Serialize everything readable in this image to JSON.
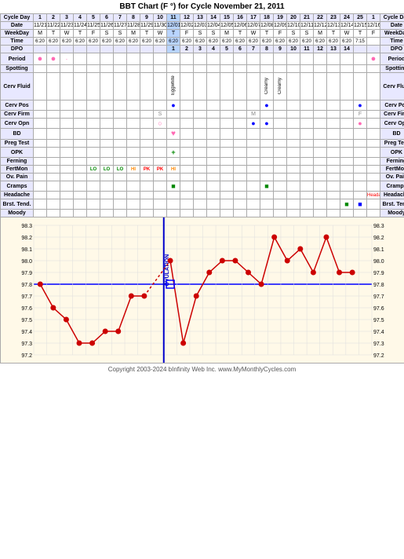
{
  "title": "BBT Chart (F °) for Cycle November 21, 2011",
  "footer": "Copyright 2003-2024 bInfinity Web Inc.    www.MyMonthlyCycles.com",
  "cycleDays": [
    "1",
    "2",
    "3",
    "4",
    "5",
    "6",
    "7",
    "8",
    "9",
    "10",
    "11",
    "12",
    "13",
    "14",
    "15",
    "16",
    "17",
    "18",
    "19",
    "20",
    "21",
    "22",
    "23",
    "24",
    "25",
    "1"
  ],
  "dates": [
    "11/21",
    "11/22",
    "11/23",
    "11/24",
    "11/25",
    "11/26",
    "11/27",
    "11/28",
    "11/29",
    "11/30",
    "12/01",
    "12/02",
    "12/03",
    "12/04",
    "12/05",
    "12/06",
    "12/07",
    "12/08",
    "12/09",
    "12/10",
    "12/11",
    "12/12",
    "12/13",
    "12/14",
    "12/15",
    "12/16"
  ],
  "weekdays": [
    "M",
    "T",
    "W",
    "T",
    "F",
    "S",
    "S",
    "M",
    "T",
    "W",
    "T",
    "F",
    "S",
    "S",
    "M",
    "T",
    "W",
    "T",
    "F",
    "S",
    "S",
    "M",
    "T",
    "W",
    "T",
    "F"
  ],
  "times": [
    "6:20",
    "6:20",
    "6:20",
    "6:20",
    "6:20",
    "6:20",
    "6:20",
    "6:20",
    "6:20",
    "6:20",
    "6:20",
    "6:20",
    "6:20",
    "6:20",
    "6:20",
    "6:20",
    "6:20",
    "6:20",
    "6:20",
    "6:20",
    "6:20",
    "6:20",
    "6:20",
    "6:20",
    "7:15",
    ""
  ],
  "dpo": [
    "",
    "",
    "",
    "",
    "",
    "",
    "",
    "",
    "",
    "",
    "1",
    "2",
    "3",
    "4",
    "5",
    "6",
    "7",
    "8",
    "9",
    "10",
    "11",
    "12",
    "13",
    "14",
    "",
    ""
  ],
  "temps": {
    "values": [
      97.8,
      97.6,
      97.5,
      97.3,
      97.3,
      97.4,
      97.4,
      97.7,
      97.7,
      null,
      98.0,
      97.3,
      97.7,
      97.9,
      98.0,
      98.0,
      97.9,
      97.8,
      98.2,
      98.0,
      98.1,
      97.9,
      98.2,
      97.9,
      97.9,
      null
    ],
    "labels": [
      "98.3",
      "98.2",
      "98.1",
      "98.0",
      "97.9",
      "97.8",
      "97.7",
      "97.6",
      "97.5",
      "97.4",
      "97.3",
      "97.2"
    ]
  },
  "period": [
    "●",
    "●",
    "·",
    "",
    "",
    "",
    "",
    "",
    "",
    "",
    "",
    "",
    "",
    "",
    "",
    "",
    "",
    "",
    "",
    "",
    "",
    "",
    "",
    "",
    "",
    "●"
  ],
  "spotting": [
    "",
    "",
    "",
    "",
    "",
    "",
    "",
    "",
    "",
    "",
    "",
    "",
    "",
    "",
    "",
    "",
    "",
    "",
    "",
    "",
    "",
    "",
    "",
    "",
    "",
    ""
  ],
  "cervFluid": [
    "",
    "",
    "",
    "",
    "",
    "",
    "",
    "",
    "",
    "",
    "Eggwhite",
    "",
    "",
    "",
    "",
    "",
    "",
    "Creamy",
    "Creamy",
    "",
    "",
    "",
    "",
    "",
    "",
    ""
  ],
  "cervPos": [
    "",
    "",
    "",
    "",
    "",
    "",
    "",
    "",
    "",
    "",
    "●",
    "",
    "",
    "",
    "",
    "",
    "",
    "●",
    "",
    "",
    "",
    "",
    "",
    "",
    "●",
    ""
  ],
  "cervFirm": [
    "",
    "",
    "",
    "",
    "",
    "",
    "",
    "",
    "",
    "S",
    "",
    "",
    "",
    "",
    "",
    "",
    "M",
    "",
    "",
    "",
    "",
    "",
    "",
    "",
    "F",
    ""
  ],
  "cervOpn": [
    "",
    "",
    "",
    "",
    "",
    "",
    "",
    "",
    "",
    "O",
    "",
    "",
    "",
    "",
    "",
    "",
    "●",
    "●",
    "",
    "",
    "",
    "",
    "",
    "",
    "●",
    ""
  ],
  "bd": [
    "",
    "",
    "",
    "",
    "",
    "",
    "",
    "",
    "",
    "",
    "♥",
    "",
    "",
    "",
    "",
    "",
    "",
    "",
    "",
    "",
    "",
    "",
    "",
    "",
    "",
    ""
  ],
  "pregTest": [
    "",
    "",
    "",
    "",
    "",
    "",
    "",
    "",
    "",
    "",
    "",
    "",
    "",
    "",
    "",
    "",
    "",
    "",
    "",
    "",
    "",
    "",
    "",
    "",
    "",
    ""
  ],
  "opk": [
    "",
    "",
    "",
    "",
    "",
    "",
    "",
    "",
    "",
    "",
    "+",
    "",
    "",
    "",
    "",
    "",
    "",
    "",
    "",
    "",
    "",
    "",
    "",
    "",
    "",
    ""
  ],
  "ferning": [
    "",
    "",
    "",
    "",
    "",
    "",
    "",
    "",
    "",
    "",
    "",
    "",
    "",
    "",
    "",
    "",
    "",
    "",
    "",
    "",
    "",
    "",
    "",
    "",
    "",
    ""
  ],
  "fertMon": [
    "",
    "",
    "",
    "",
    "LO",
    "LO",
    "LO",
    "HI",
    "PK",
    "PK",
    "HI",
    "",
    "",
    "",
    "",
    "",
    "",
    "",
    "",
    "",
    "",
    "",
    "",
    "",
    "",
    ""
  ],
  "ovPain": [
    "",
    "",
    "",
    "",
    "",
    "",
    "",
    "",
    "",
    "",
    "",
    "",
    "",
    "",
    "",
    "",
    "",
    "",
    "",
    "",
    "",
    "",
    "",
    "",
    "",
    ""
  ],
  "cramps": [
    "",
    "",
    "",
    "",
    "",
    "",
    "",
    "",
    "",
    "",
    "",
    "",
    "",
    "",
    "",
    "",
    "",
    "■",
    "",
    "",
    "",
    "",
    "",
    "",
    "",
    ""
  ],
  "headache": [
    "",
    "",
    "",
    "",
    "",
    "",
    "",
    "",
    "",
    "",
    "",
    "",
    "",
    "",
    "",
    "",
    "",
    "",
    "",
    "",
    "",
    "",
    "",
    "",
    "",
    "Headache"
  ],
  "brstTend": [
    "",
    "",
    "",
    "",
    "",
    "",
    "",
    "",
    "",
    "",
    "",
    "",
    "",
    "",
    "",
    "",
    "",
    "",
    "",
    "",
    "",
    "",
    "",
    "■",
    "■",
    ""
  ],
  "moody": [
    "",
    "",
    "",
    "",
    "",
    "",
    "",
    "",
    "",
    "",
    "",
    "",
    "",
    "",
    "",
    "",
    "",
    "",
    "",
    "",
    "",
    "",
    "",
    "",
    "",
    ""
  ]
}
